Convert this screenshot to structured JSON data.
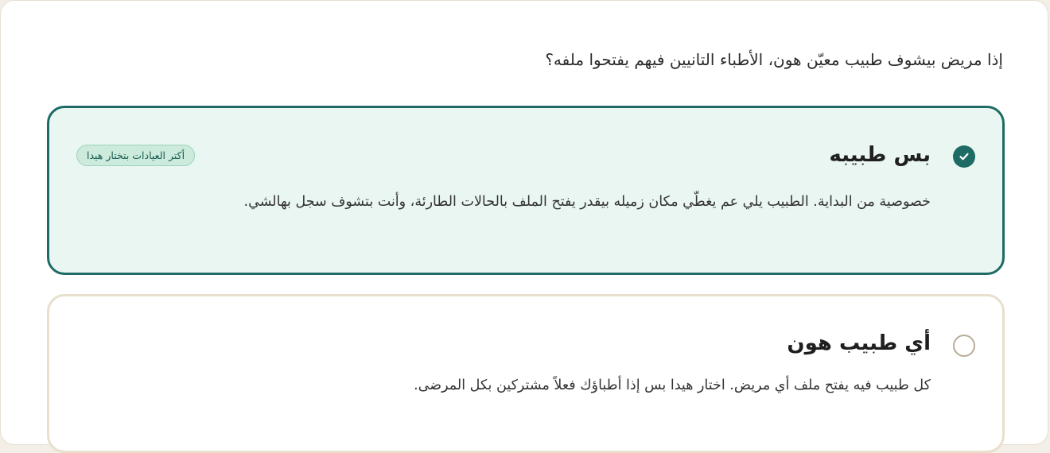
{
  "question": "إذا مريض بيشوف طبيب معيّن هون، الأطباء التانيين فيهم يفتحوا ملفه؟",
  "options": [
    {
      "title": "بس طبيبه",
      "badge": "أكتر العيادات بتختار هيدا",
      "description": "خصوصية من البداية. الطبيب يلي عم يغطّي مكان زميله بيقدر يفتح الملف بالحالات الطارئة، وأنت بتشوف سجل بهالشي.",
      "selected": true
    },
    {
      "title": "أي طبيب هون",
      "description": "كل طبيب فيه يفتح ملف أي مريض. اختار هيدا بس إذا أطباؤك فعلاً مشتركين بكل المرضى.",
      "selected": false
    }
  ],
  "colors": {
    "accent": "#1d6b64",
    "selected_bg": "#eaf6f1",
    "badge_bg": "#cdebdc",
    "unselected_border": "#e8dfcc"
  },
  "icons": {
    "selected_radio": "check-icon",
    "unselected_radio": "empty-circle"
  }
}
